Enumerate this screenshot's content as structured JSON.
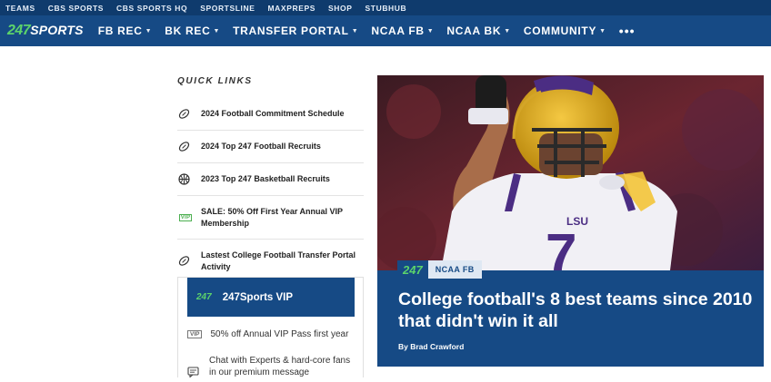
{
  "topbar": {
    "links": [
      "TEAMS",
      "CBS SPORTS",
      "CBS SPORTS HQ",
      "SPORTSLINE",
      "MAXPREPS",
      "SHOP",
      "STUBHUB"
    ]
  },
  "nav": {
    "logo_num": "247",
    "logo_word": "SPORTS",
    "items": [
      "FB REC",
      "BK REC",
      "TRANSFER PORTAL",
      "NCAA FB",
      "NCAA BK",
      "COMMUNITY"
    ],
    "more": "•••"
  },
  "quick_links": {
    "title": "QUICK LINKS",
    "items": [
      {
        "label": "2024 Football Commitment Schedule",
        "icon": "football-icon"
      },
      {
        "label": "2024 Top 247 Football Recruits",
        "icon": "football-icon"
      },
      {
        "label": "2023 Top 247 Basketball Recruits",
        "icon": "basketball-icon"
      },
      {
        "label": "SALE: 50% Off First Year Annual VIP Membership",
        "icon": "vip-badge",
        "badge": "VIP"
      },
      {
        "label": "Lastest College Football Transfer Portal Activity",
        "icon": "football-icon"
      }
    ]
  },
  "vip": {
    "button_logo": "247",
    "button_label": "247Sports VIP",
    "rows": [
      {
        "badge": "VIP",
        "text": "50% off Annual VIP Pass first year"
      },
      {
        "icon": "chat-icon",
        "text": "Chat with Experts & hard-core fans in our premium message"
      }
    ]
  },
  "hero": {
    "tag_logo": "247",
    "tag_category": "NCAA FB",
    "headline": "College football's 8 best teams since 2010 that didn't win it all",
    "byline": "By Brad Crawford",
    "jersey_number": "7",
    "jersey_text": "LSU"
  },
  "colors": {
    "topbar": "#0f3b6d",
    "nav": "#164a85",
    "accent_green": "#5cd36b"
  }
}
